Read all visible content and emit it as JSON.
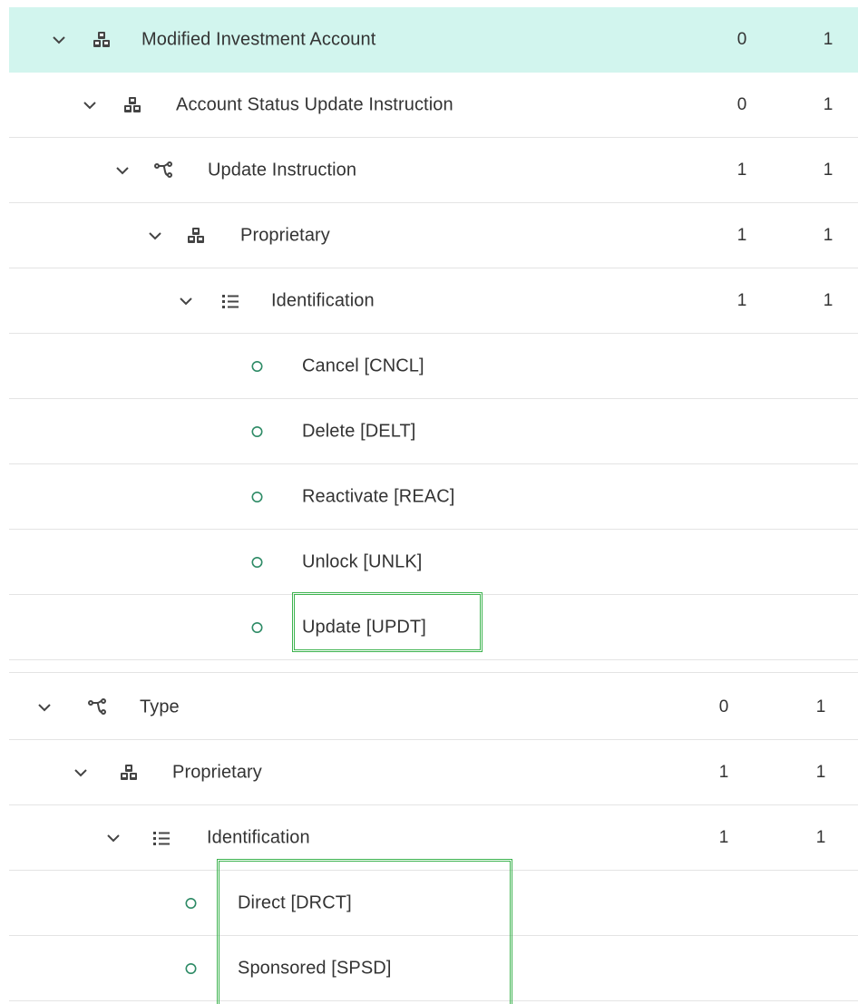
{
  "rows_top": [
    {
      "label": "Modified Investment Account",
      "icon": "cubes-icon",
      "min": "0",
      "max": "1",
      "depth": 0,
      "selected": true
    },
    {
      "label": "Account Status Update Instruction",
      "icon": "cubes-icon",
      "min": "0",
      "max": "1",
      "depth": 1
    },
    {
      "label": "Update Instruction",
      "icon": "choice-branch-icon",
      "min": "1",
      "max": "1",
      "depth": 2
    },
    {
      "label": "Proprietary",
      "icon": "cubes-icon",
      "min": "1",
      "max": "1",
      "depth": 3
    },
    {
      "label": "Identification",
      "icon": "list-icon",
      "min": "1",
      "max": "1",
      "depth": 4
    },
    {
      "label": "Cancel [CNCL]",
      "icon": "circle-icon",
      "depth": 5
    },
    {
      "label": "Delete [DELT]",
      "icon": "circle-icon",
      "depth": 5
    },
    {
      "label": "Reactivate [REAC]",
      "icon": "circle-icon",
      "depth": 5
    },
    {
      "label": "Unlock [UNLK]",
      "icon": "circle-icon",
      "depth": 5
    },
    {
      "label": "Update [UPDT]",
      "icon": "circle-icon",
      "depth": 5
    }
  ],
  "rows_bottom": [
    {
      "label": "Type",
      "icon": "choice-branch-icon",
      "min": "0",
      "max": "1",
      "depth": 0
    },
    {
      "label": "Proprietary",
      "icon": "cubes-icon",
      "min": "1",
      "max": "1",
      "depth": 1
    },
    {
      "label": "Identification",
      "icon": "list-icon",
      "min": "1",
      "max": "1",
      "depth": 2
    },
    {
      "label": "Direct [DRCT]",
      "icon": "circle-icon",
      "depth": 3
    },
    {
      "label": "Sponsored [SPSD]",
      "icon": "circle-icon",
      "depth": 3
    }
  ],
  "colors": {
    "selected_bg": "#d2f5ee",
    "highlight": "#3cb34e",
    "code_circle": "#2e8b66",
    "text": "#333333"
  }
}
